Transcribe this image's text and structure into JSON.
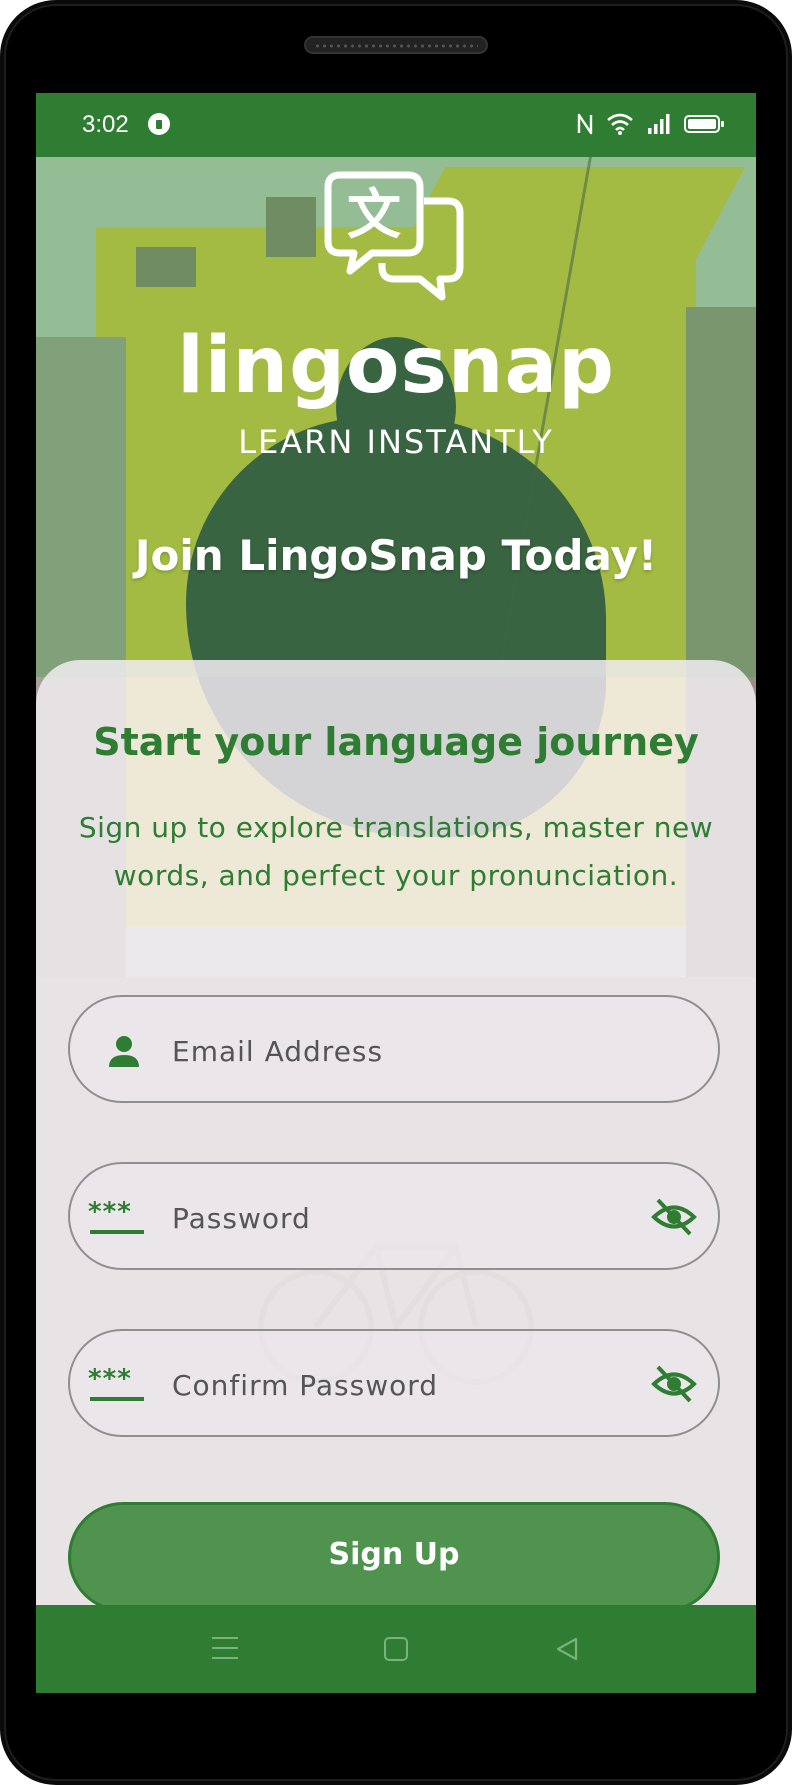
{
  "status_bar": {
    "time": "3:02"
  },
  "brand": {
    "name": "lingosnap",
    "tagline": "LEARN INSTANTLY",
    "logo_glyph": "文",
    "primary_color": "#2e7d32"
  },
  "hero": {
    "title": "Join LingoSnap Today!"
  },
  "card": {
    "title": "Start your language journey",
    "subtitle": "Sign up to explore translations, master new words, and perfect your pronunciation."
  },
  "form": {
    "email": {
      "placeholder": "Email Address",
      "value": "",
      "icon": "person-icon"
    },
    "password": {
      "placeholder": "Password",
      "value": "",
      "icon": "password-icon",
      "toggle_icon": "eye-off-icon"
    },
    "confirm_password": {
      "placeholder": "Confirm Password",
      "value": "",
      "icon": "password-icon",
      "toggle_icon": "eye-off-icon"
    },
    "submit_label": "Sign Up"
  },
  "navigation": {
    "menu_icon": "menu-icon",
    "home_icon": "home-square-icon",
    "back_icon": "back-triangle-icon"
  }
}
